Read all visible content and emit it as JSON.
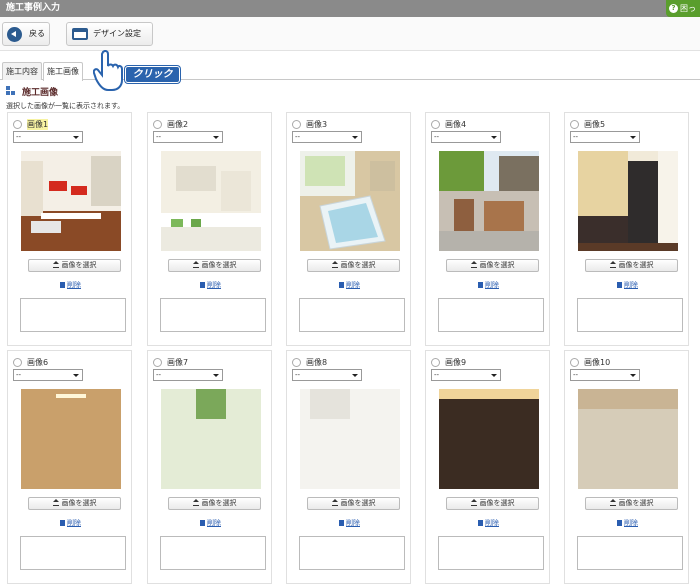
{
  "title": "施工事例入力",
  "help_label": "困っ",
  "toolbar": {
    "back_label": "戻る",
    "design_label": "デザイン設定"
  },
  "callout": "クリック",
  "tabs": [
    "施工内容",
    "施工画像"
  ],
  "section": {
    "title": "施工画像",
    "description": "選択した画像が一覧に表示されます。"
  },
  "select_default": "--",
  "pick_label": "画像を選択",
  "delete_label": "削除",
  "cards": [
    {
      "label": "画像1",
      "selected": true
    },
    {
      "label": "画像2"
    },
    {
      "label": "画像3"
    },
    {
      "label": "画像4"
    },
    {
      "label": "画像5"
    },
    {
      "label": "画像6"
    },
    {
      "label": "画像7"
    },
    {
      "label": "画像8"
    },
    {
      "label": "画像9"
    },
    {
      "label": "画像10"
    }
  ]
}
